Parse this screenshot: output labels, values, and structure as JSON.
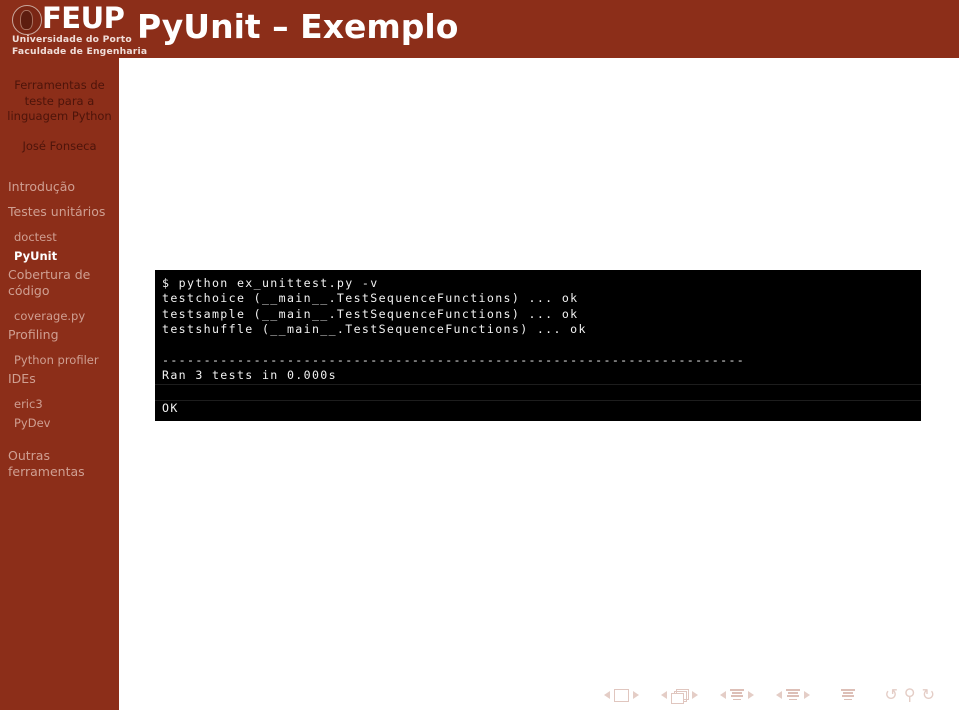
{
  "header": {
    "logo": {
      "seal_icon": "feup-seal-icon",
      "acronym": "FEUP",
      "line1": "Universidade do Porto",
      "line2": "Faculdade de Engenharia"
    },
    "title": "PyUnit – Exemplo",
    "background_color": "#8c2e19"
  },
  "sidebar": {
    "background_color": "#8c2e19",
    "presentation_title": "Ferramentas de teste para a linguagem Python",
    "author": "José Fonseca",
    "active_item": "PyUnit",
    "active_color": "#ffffff",
    "inactive_color": "#cf9f92",
    "nav": [
      {
        "label": "Introdução",
        "level": "section",
        "active": false
      },
      {
        "label": "Testes unitários",
        "level": "section",
        "active": false
      },
      {
        "label": "doctest",
        "level": "sub",
        "active": false
      },
      {
        "label": "PyUnit",
        "level": "sub",
        "active": true
      },
      {
        "label": "Cobertura de código",
        "level": "section",
        "active": false
      },
      {
        "label": "coverage.py",
        "level": "sub",
        "active": false
      },
      {
        "label": "Profiling",
        "level": "section",
        "active": false
      },
      {
        "label": "Python profiler",
        "level": "sub",
        "active": false
      },
      {
        "label": "IDEs",
        "level": "section",
        "active": false
      },
      {
        "label": "eric3",
        "level": "sub",
        "active": false
      },
      {
        "label": "PyDev",
        "level": "sub",
        "active": false
      },
      {
        "label": "Outras ferramentas",
        "level": "section",
        "active": false
      }
    ]
  },
  "terminal": {
    "background_color": "#000000",
    "text_color": "#f2f2f2",
    "lines": [
      {
        "text": "$ python ex_unittest.py -v",
        "type": "text"
      },
      {
        "text": "testchoice (__main__.TestSequenceFunctions) ... ok",
        "type": "text"
      },
      {
        "text": "testsample (__main__.TestSequenceFunctions) ... ok",
        "type": "text"
      },
      {
        "text": "testshuffle (__main__.TestSequenceFunctions) ... ok",
        "type": "text"
      },
      {
        "text": "",
        "type": "blank"
      },
      {
        "text": "----------------------------------------------------------------------",
        "type": "text"
      },
      {
        "text": "Ran 3 tests in 0.000s",
        "type": "text"
      },
      {
        "text": "",
        "type": "blank-sep"
      },
      {
        "text": "OK",
        "type": "text-sep"
      }
    ]
  },
  "navbar": {
    "groups": [
      {
        "icon": "slide-icon",
        "prev_label": "◀",
        "next_label": "▶"
      },
      {
        "icon": "frames-icon",
        "prev_label": "◀",
        "next_label": "▶"
      },
      {
        "icon": "section-icon",
        "prev_label": "◀",
        "next_label": "▶"
      },
      {
        "icon": "subsection-icon",
        "prev_label": "◀",
        "next_label": "▶"
      }
    ],
    "contents_icon": "contents-icon",
    "back_icon": "↺",
    "search_icon": "⚲",
    "forward_icon": "↻"
  }
}
